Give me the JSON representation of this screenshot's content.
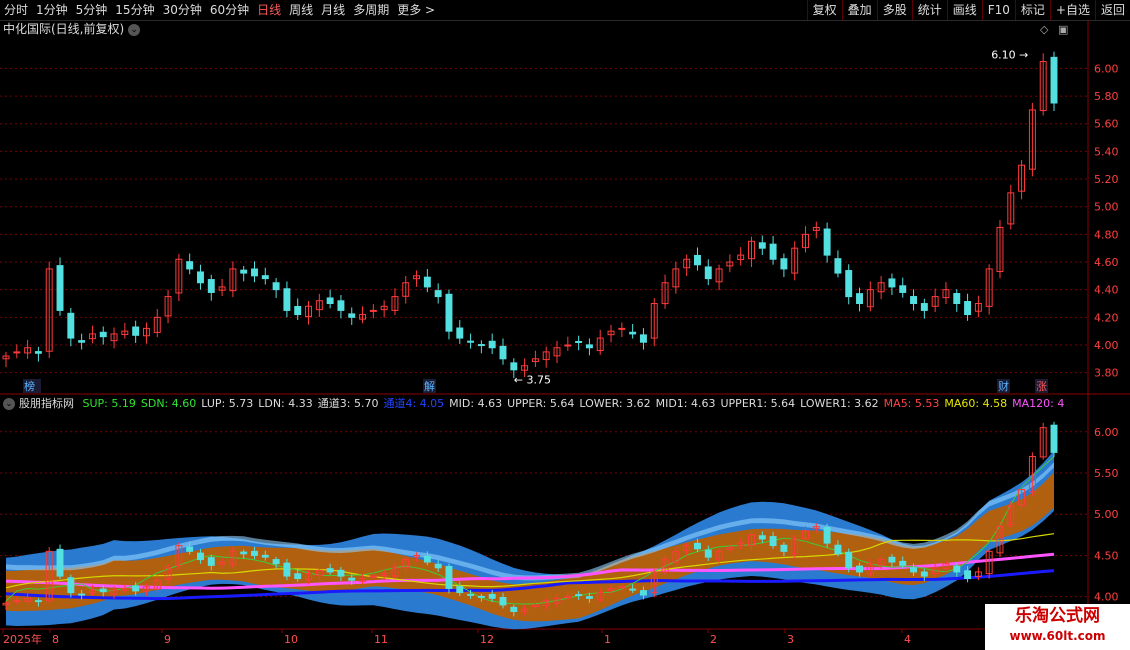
{
  "toolbar": {
    "periods": [
      "分时",
      "1分钟",
      "5分钟",
      "15分钟",
      "30分钟",
      "60分钟",
      "日线",
      "周线",
      "月线",
      "多周期",
      "更多 >"
    ],
    "active": "日线",
    "buttons": [
      "复权",
      "叠加",
      "多股",
      "统计",
      "画线",
      "F10",
      "标记",
      "+自选",
      "返回"
    ]
  },
  "stock_title": "中化国际(日线,前复权)",
  "indicator": {
    "name": "股朋指标网",
    "items": [
      {
        "label": "SUP: 5.19",
        "color": "#2ee62e"
      },
      {
        "label": "SDN: 4.60",
        "color": "#2ee62e"
      },
      {
        "label": "LUP: 5.73",
        "color": "#dddddd"
      },
      {
        "label": "LDN: 4.33",
        "color": "#dddddd"
      },
      {
        "label": "通道3: 5.70",
        "color": "#dddddd"
      },
      {
        "label": "通道4: 4.05",
        "color": "#2244ff"
      },
      {
        "label": "MID: 4.63",
        "color": "#dddddd"
      },
      {
        "label": "UPPER: 5.64",
        "color": "#dddddd"
      },
      {
        "label": "LOWER: 3.62",
        "color": "#dddddd"
      },
      {
        "label": "MID1: 4.63",
        "color": "#dddddd"
      },
      {
        "label": "UPPER1: 5.64",
        "color": "#dddddd"
      },
      {
        "label": "LOWER1: 3.62",
        "color": "#dddddd"
      },
      {
        "label": "MA5: 5.53",
        "color": "#ff4444"
      },
      {
        "label": "MA60: 4.58",
        "color": "#e6e600"
      },
      {
        "label": "MA120: 4",
        "color": "#ff55ff"
      }
    ]
  },
  "markers": [
    {
      "text": "龙虎榜",
      "color": "#5ab4ff"
    },
    {
      "text": "解",
      "color": "#5ab4ff"
    },
    {
      "text": "财",
      "color": "#5ab4ff"
    },
    {
      "text": "涨",
      "color": "#ff5555"
    }
  ],
  "annotations": {
    "high": "6.10",
    "low": "3.75"
  },
  "x_axis": [
    "2025年",
    "8",
    "9",
    "10",
    "11",
    "12",
    "1",
    "2",
    "3",
    "4"
  ],
  "watermark": {
    "line1": "乐淘公式网",
    "line2": "www.60lt.com"
  },
  "colors": {
    "up": "#ff3b3b",
    "down": "#54e0e0",
    "band_blue": "#2a7bd0",
    "band_orange": "#b0600e",
    "band_light": "#8fd0ff",
    "ma_pink": "#ff55ff",
    "ma_blue": "#1a1aff",
    "ma_green": "#3ccc3c",
    "ma_yellow": "#d8d800"
  },
  "chart_data": [
    {
      "type": "candlestick",
      "title": "中化国际(日线,前复权)",
      "y_ticks": [
        3.8,
        4.0,
        4.2,
        4.4,
        4.6,
        4.8,
        5.0,
        5.2,
        5.4,
        5.6,
        5.8,
        6.0
      ],
      "ylim": [
        3.66,
        6.22
      ],
      "x_categories": [
        "2025年",
        "8",
        "9",
        "10",
        "11",
        "12",
        "1",
        "2",
        "3",
        "4"
      ],
      "closes": [
        3.92,
        3.95,
        3.98,
        3.94,
        4.55,
        4.25,
        4.05,
        4.02,
        4.08,
        4.06,
        4.08,
        4.1,
        4.07,
        4.12,
        4.2,
        4.35,
        4.62,
        4.55,
        4.45,
        4.38,
        4.42,
        4.55,
        4.52,
        4.5,
        4.48,
        4.4,
        4.25,
        4.22,
        4.28,
        4.32,
        4.3,
        4.25,
        4.2,
        4.22,
        4.25,
        4.28,
        4.35,
        4.45,
        4.5,
        4.42,
        4.35,
        4.1,
        4.05,
        4.02,
        4.0,
        3.98,
        3.9,
        3.82,
        3.85,
        3.9,
        3.95,
        3.98,
        4.0,
        4.02,
        3.98,
        4.05,
        4.1,
        4.12,
        4.08,
        4.02,
        4.3,
        4.45,
        4.55,
        4.62,
        4.58,
        4.48,
        4.55,
        4.6,
        4.65,
        4.75,
        4.7,
        4.62,
        4.55,
        4.7,
        4.8,
        4.85,
        4.65,
        4.52,
        4.35,
        4.3,
        4.4,
        4.45,
        4.42,
        4.38,
        4.3,
        4.25,
        4.35,
        4.4,
        4.3,
        4.22,
        4.3,
        4.55,
        4.85,
        5.1,
        5.3,
        5.7,
        6.05,
        5.75
      ],
      "annotations": [
        {
          "text": "6.10",
          "value": 6.1
        },
        {
          "text": "3.75",
          "value": 3.75
        }
      ]
    },
    {
      "type": "area",
      "title": "股朋指标网",
      "y_ticks": [
        4.0,
        4.5,
        5.0,
        5.5,
        6.0
      ],
      "ylim": [
        3.62,
        6.24
      ],
      "series": [
        {
          "name": "SUP",
          "last": 5.19
        },
        {
          "name": "SDN",
          "last": 4.6
        },
        {
          "name": "LUP",
          "last": 5.73
        },
        {
          "name": "LDN",
          "last": 4.33
        },
        {
          "name": "通道3",
          "last": 5.7
        },
        {
          "name": "通道4",
          "last": 4.05
        },
        {
          "name": "MID",
          "last": 4.63
        },
        {
          "name": "UPPER",
          "last": 5.64
        },
        {
          "name": "LOWER",
          "last": 3.62
        },
        {
          "name": "MA5",
          "last": 5.53
        },
        {
          "name": "MA60",
          "last": 4.58
        },
        {
          "name": "MA120",
          "last": 4
        }
      ]
    }
  ]
}
